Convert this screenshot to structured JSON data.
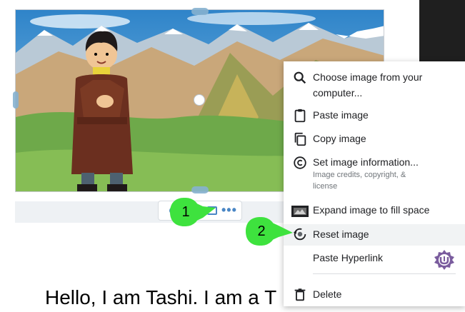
{
  "content": {
    "body_text": "Hello, I am Tashi.  I am a T"
  },
  "image_toolbar": {
    "icons": [
      "crop-circle-icon",
      "image-icon",
      "more-dots-icon"
    ],
    "more_glyph": "•••"
  },
  "context_menu": {
    "items": [
      {
        "label": "Choose image from your",
        "label2": "computer...",
        "icon": "search-icon"
      },
      {
        "label": "Paste image",
        "icon": "clipboard-icon"
      },
      {
        "label": "Copy image",
        "icon": "copy-icon"
      },
      {
        "label": "Set image information...",
        "subtext": "Image credits, copyright, &",
        "subtext2": "license",
        "icon": "copyright-icon"
      },
      {
        "label": "Expand image to fill space",
        "icon": "expand-image-icon"
      },
      {
        "label": "Reset image",
        "icon": "reset-image-icon",
        "highlighted": true
      },
      {
        "label": "Paste Hyperlink",
        "icon": "none"
      },
      {
        "label": "Delete",
        "icon": "trash-icon"
      }
    ]
  },
  "callouts": [
    {
      "number": "1"
    },
    {
      "number": "2"
    }
  ],
  "colors": {
    "callout_green": "#3ee23e",
    "menu_hover": "#f1f3f4",
    "badge_purple": "#7a5c9e",
    "accent_blue": "#4a86c5"
  }
}
